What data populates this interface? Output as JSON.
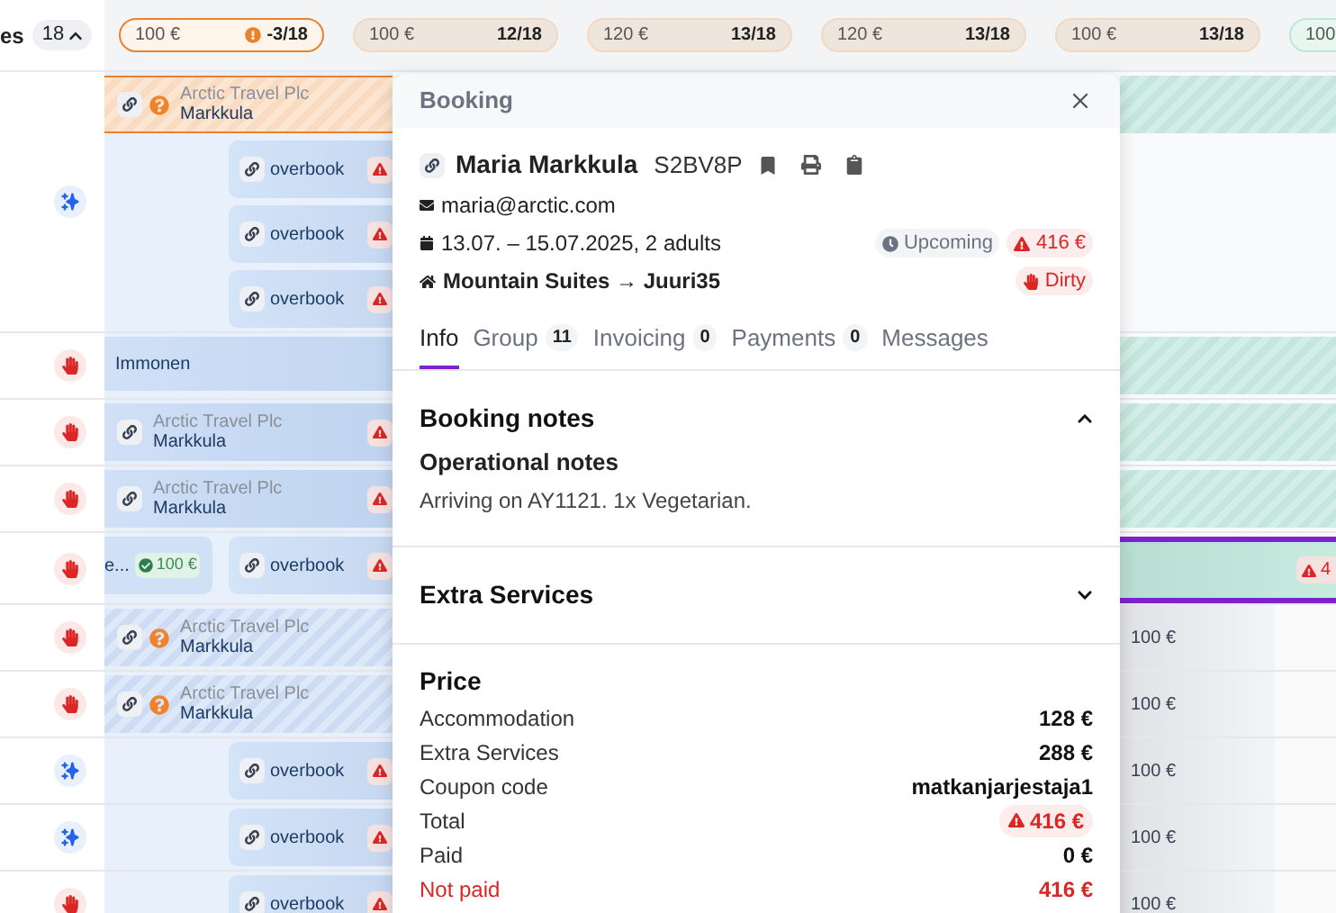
{
  "header": {
    "label": "es",
    "count": "18",
    "expanded": true,
    "pills": [
      {
        "price": "100 €",
        "count": "-3/18",
        "kind": "over"
      },
      {
        "price": "100 €",
        "count": "12/18",
        "kind": "normal"
      },
      {
        "price": "120 €",
        "count": "13/18",
        "kind": "normal"
      },
      {
        "price": "120 €",
        "count": "13/18",
        "kind": "normal"
      },
      {
        "price": "100 €",
        "count": "13/18",
        "kind": "normal"
      },
      {
        "price": "100",
        "kind": "free"
      }
    ]
  },
  "rows": [
    {
      "kind": "sparkle",
      "lines": [
        [
          {
            "kind": "pending",
            "company": "Arctic Travel Plc",
            "guest": "Markkula"
          }
        ],
        [
          {
            "kind": "overbook",
            "text": "overbook"
          }
        ],
        [
          {
            "kind": "overbook",
            "text": "overbook"
          }
        ],
        [
          {
            "kind": "overbook",
            "text": "overbook"
          }
        ]
      ],
      "right": {
        "kind": "stripe"
      }
    },
    {
      "kind": "hand",
      "lines": [
        [
          {
            "kind": "plain",
            "text": "Immonen"
          }
        ]
      ],
      "right": {
        "kind": "stripe"
      }
    },
    {
      "kind": "hand",
      "lines": [
        [
          {
            "kind": "company",
            "company": "Arctic Travel Plc",
            "guest": "Markkula"
          }
        ]
      ],
      "right": {
        "kind": "stripe"
      }
    },
    {
      "kind": "hand",
      "lines": [
        [
          {
            "kind": "company",
            "company": "Arctic Travel Plc",
            "guest": "Markkula"
          }
        ]
      ],
      "right": {
        "kind": "stripe"
      }
    },
    {
      "kind": "hand",
      "lines": [
        [
          {
            "kind": "tail",
            "text": "e...",
            "price": "100 €"
          },
          {
            "kind": "overbook",
            "text": "overbook"
          }
        ]
      ],
      "right": {
        "kind": "selected",
        "badge": "4"
      }
    },
    {
      "kind": "hand",
      "lines": [
        [
          {
            "kind": "unpaid",
            "company": "Arctic Travel Plc",
            "guest": "Markkula"
          }
        ]
      ],
      "right": {
        "kind": "price",
        "text": "100 €"
      }
    },
    {
      "kind": "hand",
      "lines": [
        [
          {
            "kind": "unpaid",
            "company": "Arctic Travel Plc",
            "guest": "Markkula"
          }
        ]
      ],
      "right": {
        "kind": "price",
        "text": "100 €"
      }
    },
    {
      "kind": "sparkle",
      "lines": [
        [
          {
            "kind": "overbook",
            "text": "overbook"
          }
        ]
      ],
      "right": {
        "kind": "price",
        "text": "100 €"
      }
    },
    {
      "kind": "sparkle",
      "lines": [
        [
          {
            "kind": "overbook",
            "text": "overbook"
          }
        ]
      ],
      "right": {
        "kind": "price",
        "text": "100 €"
      }
    },
    {
      "kind": "hand",
      "lines": [
        [
          {
            "kind": "overbook",
            "text": "overbook"
          }
        ]
      ],
      "right": {
        "kind": "price",
        "text": "100 €"
      }
    }
  ],
  "modal": {
    "title": "Booking",
    "guest": "Maria Markkula",
    "code": "S2BV8P",
    "email": "maria@arctic.com",
    "dates": "13.07. – 15.07.2025, 2 adults",
    "status": "Upcoming",
    "balance": "416 €",
    "room": "Mountain Suites → Juuri35",
    "housekeeping": "Dirty",
    "tabs": [
      {
        "label": "Info",
        "selected": true
      },
      {
        "label": "Group",
        "count": "11",
        "selected": false
      },
      {
        "label": "Invoicing",
        "count": "0",
        "selected": false
      },
      {
        "label": "Payments",
        "count": "0",
        "selected": false
      },
      {
        "label": "Messages",
        "selected": false
      }
    ],
    "sections": [
      {
        "title": "Booking notes",
        "expanded": true,
        "subtitle": "Operational notes",
        "text": "Arriving on AY1121. 1x Vegetarian."
      },
      {
        "title": "Extra Services",
        "expanded": false
      }
    ],
    "price": {
      "title": "Price",
      "rows": [
        {
          "label": "Accommodation",
          "value": "128 €",
          "kind": "plain"
        },
        {
          "label": "Extra Services",
          "value": "288 €",
          "kind": "plain"
        },
        {
          "label": "Coupon code",
          "value": "matkanjarjestaja1",
          "kind": "plain"
        },
        {
          "label": "Total",
          "value": "416 €",
          "kind": "warning"
        },
        {
          "label": "Paid",
          "value": "0 €",
          "kind": "plain"
        },
        {
          "label": "Not paid",
          "value": "416 €",
          "kind": "due"
        }
      ]
    }
  }
}
